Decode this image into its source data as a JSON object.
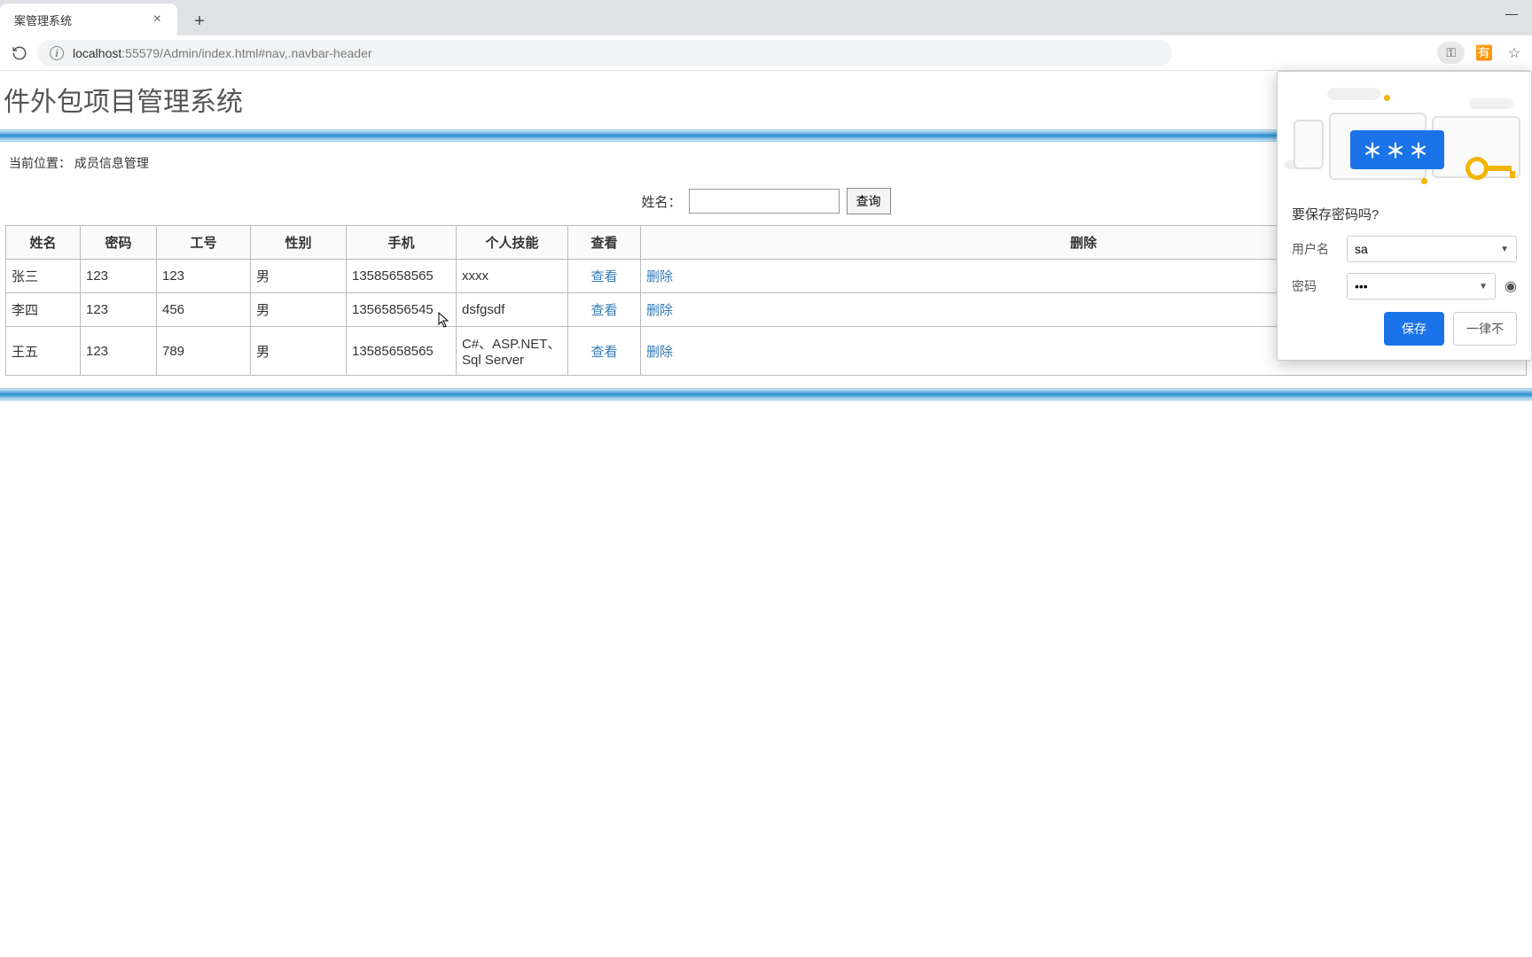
{
  "browser": {
    "tab_title": "案管理系统",
    "url_host": "localhost",
    "url_port": ":55579",
    "url_path": "/Admin/index.html#nav,.navbar-header",
    "new_tab": "+",
    "minimize": "—",
    "info_icon": "i",
    "key_pill": "⚿",
    "translate_icon": "🈶",
    "star_icon": "☆"
  },
  "page": {
    "title": "件外包项目管理系统",
    "breadcrumb_prefix": "当前位置：",
    "breadcrumb_value": "成员信息管理"
  },
  "search": {
    "label": "姓名：",
    "button": "查询",
    "value": ""
  },
  "table": {
    "headers": {
      "name": "姓名",
      "password": "密码",
      "emp_no": "工号",
      "gender": "性别",
      "phone": "手机",
      "skills": "个人技能",
      "view": "查看",
      "delete": "删除"
    },
    "view_link": "查看",
    "delete_link": "删除",
    "rows": [
      {
        "name": "张三",
        "password": "123",
        "emp_no": "123",
        "gender": "男",
        "phone": "13585658565",
        "skills": "xxxx"
      },
      {
        "name": "李四",
        "password": "123",
        "emp_no": "456",
        "gender": "男",
        "phone": "13565856545",
        "skills": "dsfgsdf"
      },
      {
        "name": "王五",
        "password": "123",
        "emp_no": "789",
        "gender": "男",
        "phone": "13585658565",
        "skills": "C#、ASP.NET、Sql Server"
      }
    ]
  },
  "popup": {
    "question": "要保存密码吗?",
    "username_label": "用户名",
    "username_value": "sa",
    "password_label": "密码",
    "password_masked": "•••",
    "save": "保存",
    "never": "一律不",
    "illus_stars": "＊＊＊"
  }
}
